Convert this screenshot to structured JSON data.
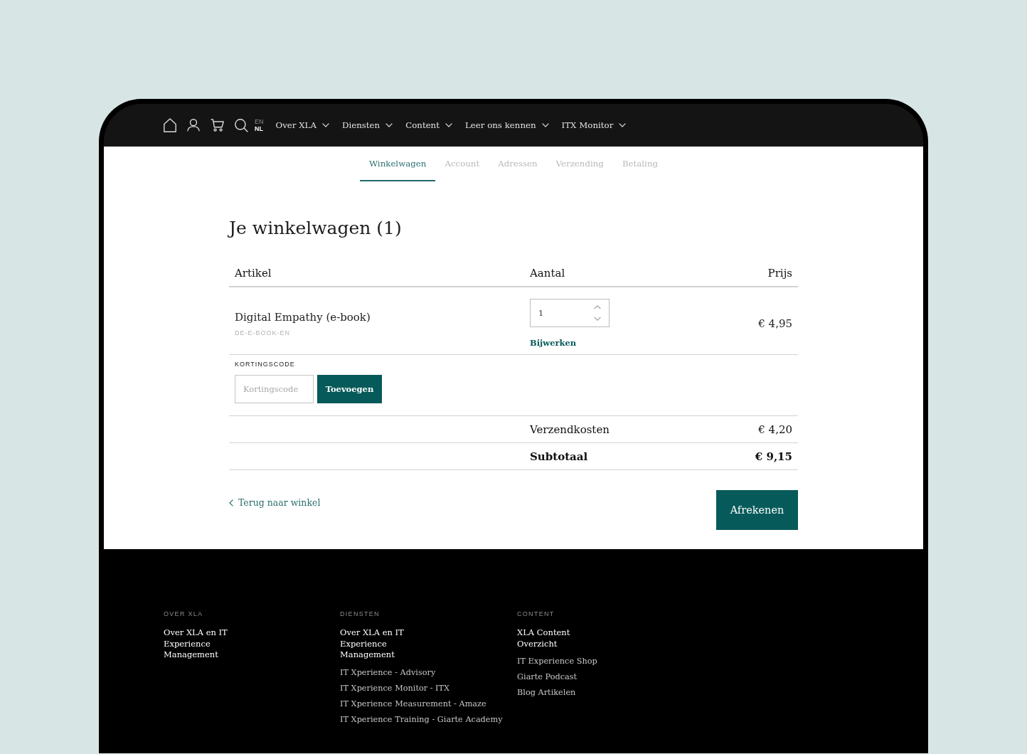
{
  "nav": {
    "languages": [
      {
        "label": "EN",
        "selected": false
      },
      {
        "label": "NL",
        "selected": true
      }
    ],
    "menu": [
      {
        "label": "Over XLA"
      },
      {
        "label": "Diensten"
      },
      {
        "label": "Content"
      },
      {
        "label": "Leer ons kennen"
      },
      {
        "label": "ITX Monitor"
      }
    ]
  },
  "steps": [
    {
      "label": "Winkelwagen",
      "selected": true
    },
    {
      "label": "Account",
      "selected": false
    },
    {
      "label": "Adressen",
      "selected": false
    },
    {
      "label": "Verzending",
      "selected": false
    },
    {
      "label": "Betaling",
      "selected": false
    }
  ],
  "title": "Je winkelwagen (1)",
  "cart": {
    "columns": [
      "Artikel",
      "Aantal",
      "Prijs"
    ],
    "items": [
      {
        "name": "Digital Empathy (e-book)",
        "sku": "DE-E-BOOK-EN",
        "quantity": "1",
        "update_label": "Bijwerken",
        "price": "€ 4,95"
      }
    ]
  },
  "discount": {
    "label": "KORTINGSCODE",
    "placeholder": "Kortingscode",
    "button": "Toevoegen"
  },
  "totals": [
    {
      "label": "Verzendkosten",
      "value": "€ 4,20",
      "kind": "regular"
    },
    {
      "label": "Subtotaal",
      "value": "€ 9,15",
      "kind": "total"
    }
  ],
  "back_link": "Terug naar winkel",
  "checkout_button": "Afrekenen",
  "footer": {
    "columns": [
      {
        "heading": "OVER XLA",
        "links": [
          {
            "label": "Over XLA en IT Experience Management",
            "kind": "main"
          }
        ]
      },
      {
        "heading": "DIENSTEN",
        "links": [
          {
            "label": "Over XLA en IT Experience Management",
            "kind": "main"
          },
          {
            "label": "IT Xperience - Advisory",
            "kind": "sub"
          },
          {
            "label": "IT Xperience Monitor - ITX",
            "kind": "sub"
          },
          {
            "label": "IT Xperience Measurement - Amaze",
            "kind": "sub"
          },
          {
            "label": "IT Xperience Training - Giarte Academy",
            "kind": "sub"
          }
        ]
      },
      {
        "heading": "CONTENT",
        "links": [
          {
            "label": "XLA Content Overzicht",
            "kind": "main"
          },
          {
            "label": "IT Experience Shop",
            "kind": "sub"
          },
          {
            "label": "Giarte Podcast",
            "kind": "sub"
          },
          {
            "label": "Blog Artikelen",
            "kind": "sub"
          }
        ]
      }
    ]
  }
}
